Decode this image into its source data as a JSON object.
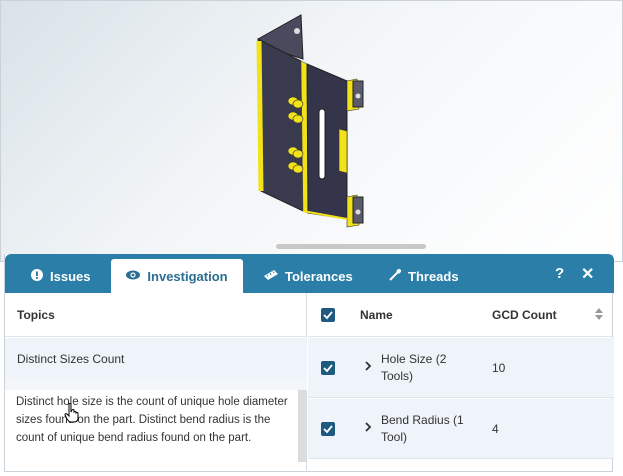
{
  "tabs": [
    {
      "label": "Issues",
      "icon": "exclamation-circle-icon",
      "active": false
    },
    {
      "label": "Investigation",
      "icon": "eye-icon",
      "active": true
    },
    {
      "label": "Tolerances",
      "icon": "ruler-icon",
      "active": false
    },
    {
      "label": "Threads",
      "icon": "thread-tool-icon",
      "active": false
    }
  ],
  "toolbar": {
    "help_label": "?",
    "close_label": "✕"
  },
  "topics": {
    "header": "Topics",
    "items": [
      {
        "label": "Distinct Sizes Count",
        "selected": true
      }
    ],
    "description": "Distinct hole size is the count of unique hole diameter sizes found on the part. Distinct bend radius is the count of unique bend radius found on the part."
  },
  "grid": {
    "columns": {
      "name": "Name",
      "count": "GCD Count"
    },
    "rows": [
      {
        "name": "Hole Size (2 Tools)",
        "count": "10",
        "checked": true
      },
      {
        "name": "Bend Radius (1 Tool)",
        "count": "4",
        "checked": true
      }
    ]
  },
  "colors": {
    "tabbar": "#2a7ea7",
    "checkbox": "#1e5a80",
    "highlight": "#f2e21a",
    "part": "#3a3a4e"
  }
}
